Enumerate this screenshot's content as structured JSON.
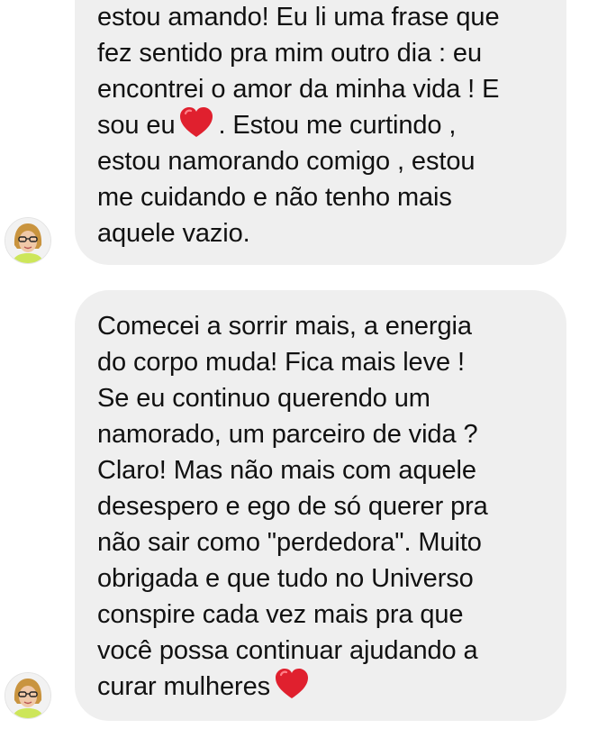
{
  "messages": [
    {
      "id": "msg-1",
      "lines": [
        {
          "text": "estou amando! Eu li uma frase que"
        },
        {
          "text": "fez sentido pra mim outro dia : eu"
        },
        {
          "text": "encontrei o amor da minha vida ! E"
        },
        {
          "pre": "sou eu",
          "emoji": "red-heart-emoji",
          "post": ". Estou me curtindo ,"
        },
        {
          "text": "estou namorando comigo , estou"
        },
        {
          "text": "me cuidando e não tenho mais"
        },
        {
          "text": "aquele vazio."
        }
      ]
    },
    {
      "id": "msg-2",
      "lines": [
        {
          "text": "Comecei a sorrir mais, a energia"
        },
        {
          "text": "do corpo muda! Fica mais leve !"
        },
        {
          "text": "Se eu continuo querendo um"
        },
        {
          "text": "namorado, um parceiro de vida ?"
        },
        {
          "text": "Claro! Mas não mais com aquele"
        },
        {
          "text": "desespero e ego de só querer pra"
        },
        {
          "text": "não sair como \"perdedora\". Muito"
        },
        {
          "text": "obrigada e que tudo no Universo"
        },
        {
          "text": "conspire cada vez mais pra que"
        },
        {
          "text": "você possa continuar ajudando a"
        },
        {
          "pre": "curar mulheres",
          "emoji": "red-heart-emoji",
          "post": ""
        }
      ]
    }
  ],
  "colors": {
    "bubble_background": "#efefef",
    "text": "#111111",
    "heart": "#e0202e",
    "avatar_top": "#c9943f"
  },
  "icons": [
    "avatar-photo",
    "red-heart-emoji"
  ]
}
